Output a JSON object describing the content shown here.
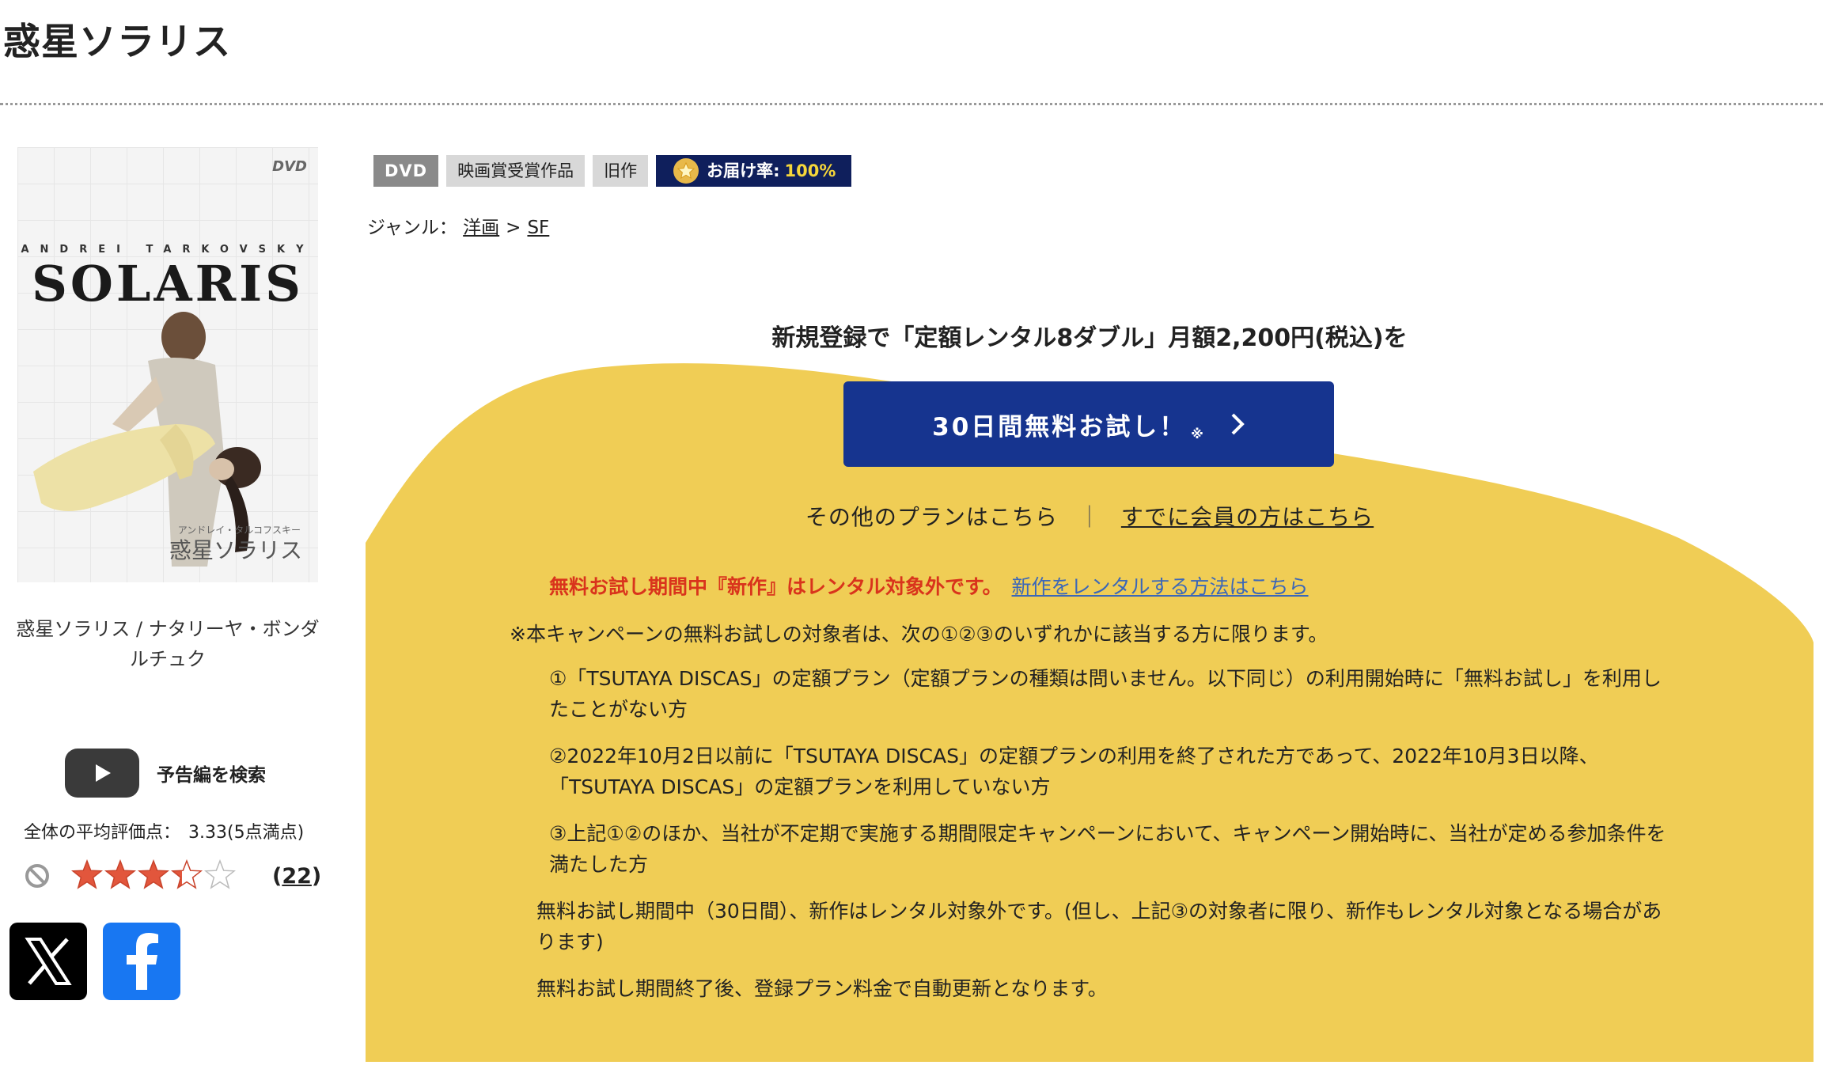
{
  "page": {
    "title": "惑星ソラリス"
  },
  "jacket": {
    "dvd_mark": "DVD",
    "director": "ANDREI TARKOVSKY",
    "logo": "SOLARIS",
    "jp_small": "アンドレイ・タルコフスキー",
    "jp_title": "惑星ソラリス"
  },
  "left": {
    "caption": "惑星ソラリス / ナタリーヤ・ボンダルチュク",
    "trailer_label": "予告編を検索",
    "rating_label": "全体の平均評価点：",
    "rating_value": "3.33(5点満点)",
    "rating_stars": 3.33,
    "review_count": "22"
  },
  "tags": [
    {
      "label": "DVD"
    },
    {
      "label": "映画賞受賞作品"
    },
    {
      "label": "旧作"
    }
  ],
  "delivery": {
    "label": "お届け率:",
    "value": "100%"
  },
  "genre": {
    "label": "ジャンル：",
    "items": [
      "洋画",
      "SF"
    ],
    "separator": ">"
  },
  "promo": {
    "headline": "新規登録で「定額レンタル8ダブル」月額2,200円(税込)を",
    "cta": "30日間無料お試し！",
    "cta_note": "※",
    "other_plans": "その他のプランはこちら",
    "divider": "｜",
    "member_link": "すでに会員の方はこちら"
  },
  "notice": {
    "warning": "無料お試し期間中『新作』はレンタル対象外です。",
    "link": "新作をレンタルする方法はこちら"
  },
  "conditions": {
    "head": "※本キャンペーンの無料お試しの対象者は、次の①②③のいずれかに該当する方に限ります。",
    "items": [
      "①「TSUTAYA DISCAS」の定額プラン（定額プランの種類は問いません。以下同じ）の利用開始時に「無料お試し」を利用したことがない方",
      "②2022年10月2日以前に「TSUTAYA DISCAS」の定額プランの利用を終了された方であって、2022年10月3日以降、「TSUTAYA DISCAS」の定額プランを利用していない方",
      "③上記①②のほか、当社が不定期で実施する期間限定キャンペーンにおいて、キャンペーン開始時に、当社が定める参加条件を満たした方"
    ],
    "note1": "無料お試し期間中（30日間）、新作はレンタル対象外です。(但し、上記③の対象者に限り、新作もレンタル対象となる場合があります)",
    "note2": "無料お試し期間終了後、登録プラン料金で自動更新となります。"
  },
  "colors": {
    "campaign_bg": "#f0cd55",
    "cta": "#16348f",
    "warning": "#d9341c",
    "link": "#3b67b8",
    "delivery_badge": "#0f1f5c"
  }
}
